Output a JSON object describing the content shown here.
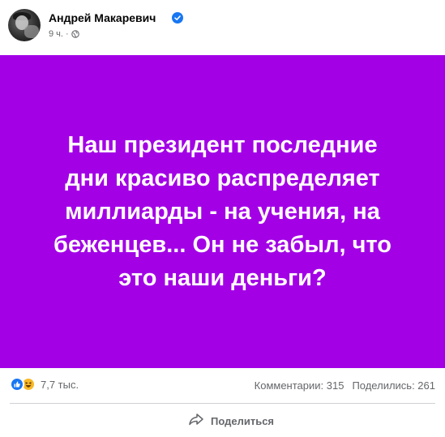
{
  "post": {
    "author": "Андрей Макаревич",
    "time": "9 ч.",
    "separator": "·",
    "icons": {
      "verified": "verified-badge-icon",
      "audience": "globe-icon"
    }
  },
  "card": {
    "background": "#a300e6",
    "text_color": "#ffffff",
    "lines": [
      "Наш президент последние",
      "дни красиво распределяет",
      "миллиарды - на учения, на",
      "беженцев... Он не забыл, что",
      "это наши деньги?"
    ]
  },
  "stats": {
    "reaction_icons": [
      "like-reaction-icon",
      "haha-reaction-icon"
    ],
    "reactions_count": "7,7 тыс.",
    "comments": "Комментарии: 315",
    "shares": "Поделились: 261"
  },
  "actions": {
    "share_label": "Поделиться",
    "share_icon": "share-arrow-icon"
  }
}
